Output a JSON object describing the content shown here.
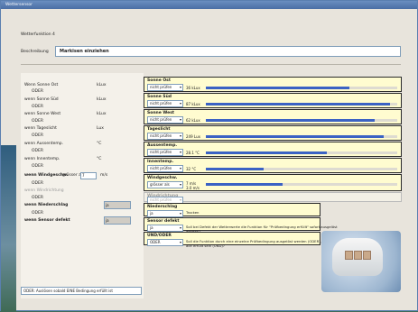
{
  "title": "Wettersensor",
  "group_label": "Wetterfunktion 4",
  "description_label": "Beschreibung",
  "description_value": "Markisen einziehen",
  "left_rows": [
    {
      "label": "Wenn Sonne Ost",
      "unit": "kLux"
    },
    {
      "label": "ODER"
    },
    {
      "label": "wenn Sonne Süd",
      "unit": "kLux"
    },
    {
      "label": "ODER"
    },
    {
      "label": "wenn Sonne West",
      "unit": "kLux"
    },
    {
      "label": "ODER"
    },
    {
      "label": "wenn Tageslicht",
      "unit": "Lux"
    },
    {
      "label": "ODER"
    },
    {
      "label": "wenn Aussentemp.",
      "unit": "°C"
    },
    {
      "label": "ODER"
    },
    {
      "label": "wenn Innentemp.",
      "unit": "°C"
    },
    {
      "label": "ODER"
    },
    {
      "label": "wenn Windgeschw.",
      "extra": "grösser als",
      "box": "7",
      "unit": "m/s"
    },
    {
      "label": "ODER"
    },
    {
      "label": "wenn Windrichtung"
    },
    {
      "label": "ODER"
    },
    {
      "label": "wenn Niederschlag",
      "box2": "ja"
    },
    {
      "label": "ODER"
    },
    {
      "label": "wenn Sensor defekt",
      "box2": "ja"
    }
  ],
  "status_text": "ODER: Auslösen sobald EINE Bedingung erfüllt ist",
  "panels": [
    {
      "title": "Sonne Ost",
      "select": "nicht prüfen",
      "value": "36 kLux",
      "level": 0.75
    },
    {
      "title": "Sonne Süd",
      "select": "nicht prüfen",
      "value": "87 kLux",
      "level": 0.96
    },
    {
      "title": "Sonne West",
      "select": "nicht prüfen",
      "value": "62 kLux",
      "level": 0.88
    },
    {
      "title": "Tageslicht",
      "select": "nicht prüfen",
      "value": "249 Lux",
      "level": 0.93
    },
    {
      "title": "Aussentemp.",
      "select": "nicht prüfen",
      "value": "28.1 °C",
      "level": 0.63
    },
    {
      "title": "Innentemp.",
      "select": "nicht prüfen",
      "value": "32 °C",
      "level": 0.3
    },
    {
      "title": "Windgeschw.",
      "select": "grösser als",
      "value": "7 m/s",
      "value2": "3.0 m/s",
      "level": 0.4
    },
    {
      "title": "Windrichtung",
      "select": "nicht prüfen"
    },
    {
      "title": "Niederschlag",
      "select": "ja",
      "text": "Trocken"
    },
    {
      "title": "Sensor defekt",
      "select": "ja",
      "text": "Soll bei Defekt der Wetterwerte die Funktion für \"Prüfbedingung erfüllt\" sofort ausgelöst werden?"
    },
    {
      "title": "UND/ODER",
      "select": "ODER",
      "text": "Soll die Funktion durch eine einzelne Prüfbedingung ausgelöst werden (ODER), oder müssen alle erfüllt sein (UND)?"
    }
  ]
}
